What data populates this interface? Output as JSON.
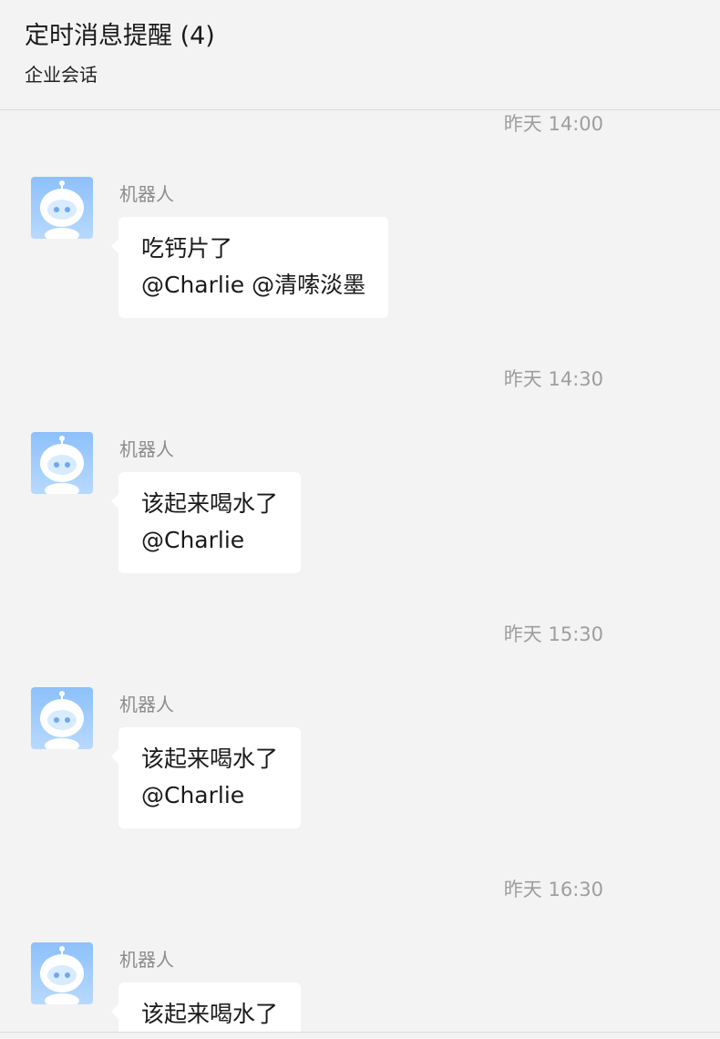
{
  "header": {
    "title": "定时消息提醒 (4)",
    "subtitle": "企业会话"
  },
  "colors": {
    "background": "#f3f3f3",
    "bubble": "#ffffff",
    "timestamp": "#9e9e9e",
    "avatar_top": "#8dc0fb",
    "avatar_bottom": "#b7d9ff"
  },
  "messages": [
    {
      "timestamp": "昨天 14:00",
      "sender": "机器人",
      "avatar_icon": "robot-avatar-icon",
      "lines": [
        "吃钙片了",
        "@Charlie @清嗦淡墨"
      ]
    },
    {
      "timestamp": "昨天 14:30",
      "sender": "机器人",
      "avatar_icon": "robot-avatar-icon",
      "lines": [
        "该起来喝水了",
        "@Charlie"
      ]
    },
    {
      "timestamp": "昨天 15:30",
      "sender": "机器人",
      "avatar_icon": "robot-avatar-icon",
      "lines": [
        "该起来喝水了",
        "@Charlie"
      ]
    },
    {
      "timestamp": "昨天 16:30",
      "sender": "机器人",
      "avatar_icon": "robot-avatar-icon",
      "lines": [
        "该起来喝水了"
      ]
    }
  ]
}
